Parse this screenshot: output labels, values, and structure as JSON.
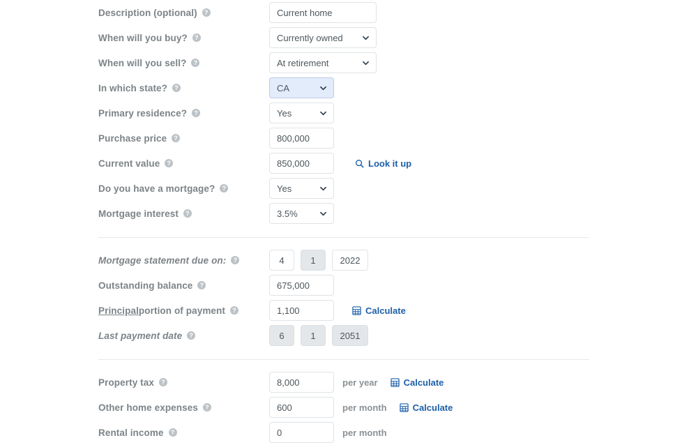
{
  "form": {
    "section_main": [
      {
        "label": "Description (optional)",
        "help": "?",
        "control": "text",
        "value": "Current home",
        "width": "wide"
      },
      {
        "label": "When will you buy?",
        "help": "?",
        "control": "select",
        "value": "Currently owned",
        "width": "wide"
      },
      {
        "label": "When will you sell?",
        "help": "?",
        "control": "select",
        "value": "At retirement",
        "width": "wide"
      },
      {
        "label": "In which state?",
        "help": "?",
        "control": "select",
        "value": "CA",
        "width": "narrow",
        "focused": true
      },
      {
        "label": "Primary residence?",
        "help": "?",
        "control": "select",
        "value": "Yes",
        "width": "narrow"
      },
      {
        "label": "Purchase price",
        "help": "?",
        "control": "text",
        "value": "800,000",
        "width": "narrow"
      },
      {
        "label": "Current value",
        "help": "?",
        "control": "text",
        "value": "850,000",
        "width": "narrow",
        "action": "Look it up",
        "action_icon": "search-icon"
      },
      {
        "label": "Do you have a mortgage?",
        "help": "?",
        "control": "select",
        "value": "Yes",
        "width": "narrow"
      },
      {
        "label": "Mortgage interest",
        "help": "?",
        "control": "select",
        "value": "3.5%",
        "width": "narrow"
      }
    ],
    "section_mortgage": {
      "statement_due": {
        "label": "Mortgage statement due on:",
        "help": "?",
        "month": "4",
        "day": "1",
        "year": "2022"
      },
      "outstanding_balance": {
        "label": "Outstanding balance",
        "help": "?",
        "value": "675,000"
      },
      "principal": {
        "label_link": "Principal",
        "label_rest": " portion of payment",
        "help": "?",
        "value": "1,100",
        "action": "Calculate",
        "action_icon": "calculator-icon"
      },
      "last_payment": {
        "label": "Last payment date",
        "help": "?",
        "month": "6",
        "day": "1",
        "year": "2051"
      }
    },
    "section_expenses": [
      {
        "label": "Property tax",
        "help": "?",
        "value": "8,000",
        "unit": "per year",
        "action": "Calculate",
        "action_icon": "calculator-icon"
      },
      {
        "label": "Other home expenses",
        "help": "?",
        "value": "600",
        "unit": "per month",
        "action": "Calculate",
        "action_icon": "calculator-icon"
      },
      {
        "label": "Rental income",
        "help": "?",
        "value": "0",
        "unit": "per month"
      }
    ]
  },
  "colors": {
    "label": "#7c8387",
    "link": "#1d5fa8",
    "focus_fill": "#e3ecfb",
    "border": "#dfe3e6",
    "muted_fill": "#e4e7ea"
  }
}
